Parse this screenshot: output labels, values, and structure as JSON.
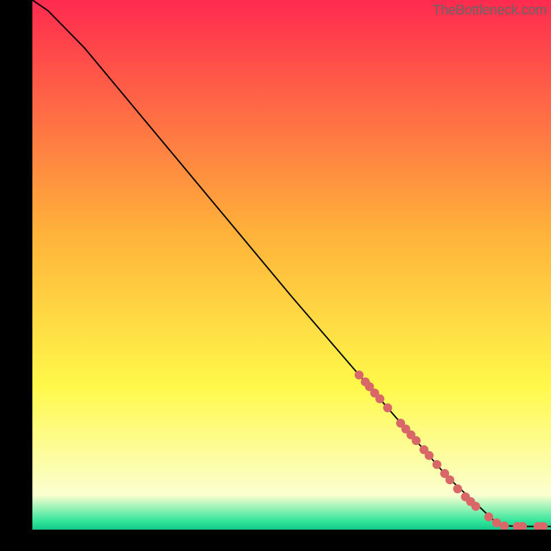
{
  "attribution": "TheBottleneck.com",
  "colors": {
    "bg": "#000000",
    "grad_top": "#ff2a4f",
    "grad_mid1": "#ffb23a",
    "grad_mid2": "#fff94a",
    "grad_pale": "#fbffd0",
    "grad_green": "#2fe59a",
    "line": "#000000",
    "marker": "#d96767",
    "text": "#666666"
  },
  "chart_data": {
    "type": "line",
    "title": "",
    "xlabel": "",
    "ylabel": "",
    "xlim": [
      0,
      100
    ],
    "ylim": [
      0,
      100
    ],
    "series": [
      {
        "name": "curve",
        "x": [
          0,
          3,
          6,
          10,
          30,
          50,
          63,
          70,
          80,
          90,
          92,
          94,
          96,
          98,
          100
        ],
        "y": [
          100,
          98,
          95,
          91,
          67.5,
          44,
          29.2,
          21.3,
          10,
          0.8,
          0.7,
          0.6,
          0.6,
          0.6,
          0.6
        ]
      }
    ],
    "markers": [
      {
        "x": 63.0,
        "y": 29.2
      },
      {
        "x": 64.2,
        "y": 27.9
      },
      {
        "x": 65.0,
        "y": 27.0
      },
      {
        "x": 66.0,
        "y": 25.8
      },
      {
        "x": 67.0,
        "y": 24.7
      },
      {
        "x": 68.5,
        "y": 23.0
      },
      {
        "x": 71.0,
        "y": 20.1
      },
      {
        "x": 72.0,
        "y": 19.0
      },
      {
        "x": 73.0,
        "y": 17.9
      },
      {
        "x": 74.0,
        "y": 16.8
      },
      {
        "x": 75.5,
        "y": 15.1
      },
      {
        "x": 76.5,
        "y": 14.0
      },
      {
        "x": 78.0,
        "y": 12.3
      },
      {
        "x": 79.5,
        "y": 10.6
      },
      {
        "x": 80.5,
        "y": 9.4
      },
      {
        "x": 82.0,
        "y": 7.7
      },
      {
        "x": 83.5,
        "y": 6.2
      },
      {
        "x": 84.5,
        "y": 5.3
      },
      {
        "x": 85.5,
        "y": 4.4
      },
      {
        "x": 88.0,
        "y": 2.4
      },
      {
        "x": 89.5,
        "y": 1.3
      },
      {
        "x": 91.0,
        "y": 0.7
      },
      {
        "x": 93.5,
        "y": 0.6
      },
      {
        "x": 94.5,
        "y": 0.6
      },
      {
        "x": 97.5,
        "y": 0.6
      },
      {
        "x": 98.5,
        "y": 0.6
      }
    ]
  }
}
